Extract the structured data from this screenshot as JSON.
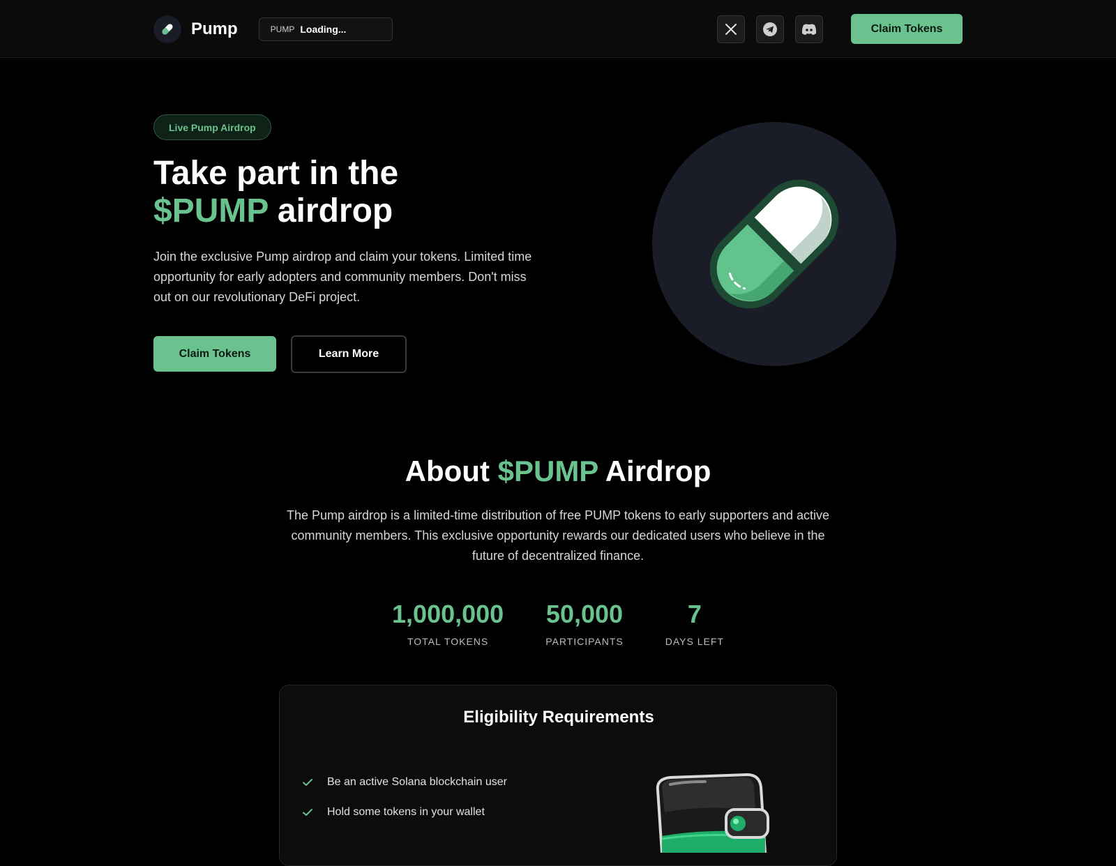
{
  "nav": {
    "brand": "Pump",
    "price_symbol": "PUMP",
    "price_value": "Loading...",
    "socials": [
      "x-icon",
      "telegram-icon",
      "discord-icon"
    ],
    "cta_label": "Claim Tokens"
  },
  "hero": {
    "badge": "Live Pump Airdrop",
    "title_line1": "Take part in the",
    "title_accent": "$PUMP",
    "title_line2_rest": "airdrop",
    "description": "Join the exclusive Pump airdrop and claim your tokens. Limited time opportunity for early adopters and community members. Don't miss out on our revolutionary DeFi project.",
    "primary_label": "Claim Tokens",
    "secondary_label": "Learn More"
  },
  "about": {
    "title_prefix": "About",
    "title_accent": "$PUMP",
    "title_suffix": "Airdrop",
    "description": "The Pump airdrop is a limited-time distribution of free PUMP tokens to early supporters and active community members. This exclusive opportunity rewards our dedicated users who believe in the future of decentralized finance.",
    "stats": [
      {
        "value": "1,000,000",
        "label": "TOTAL TOKENS"
      },
      {
        "value": "50,000",
        "label": "PARTICIPANTS"
      },
      {
        "value": "7",
        "label": "DAYS LEFT"
      }
    ]
  },
  "eligibility": {
    "title": "Eligibility Requirements",
    "items": [
      "Be an active Solana blockchain user",
      "Hold some tokens in your wallet"
    ]
  },
  "colors": {
    "accent": "#6ac38e",
    "background": "#000000",
    "nav_bg": "#0b0b0b",
    "pill_circle": "#1a1c27"
  }
}
